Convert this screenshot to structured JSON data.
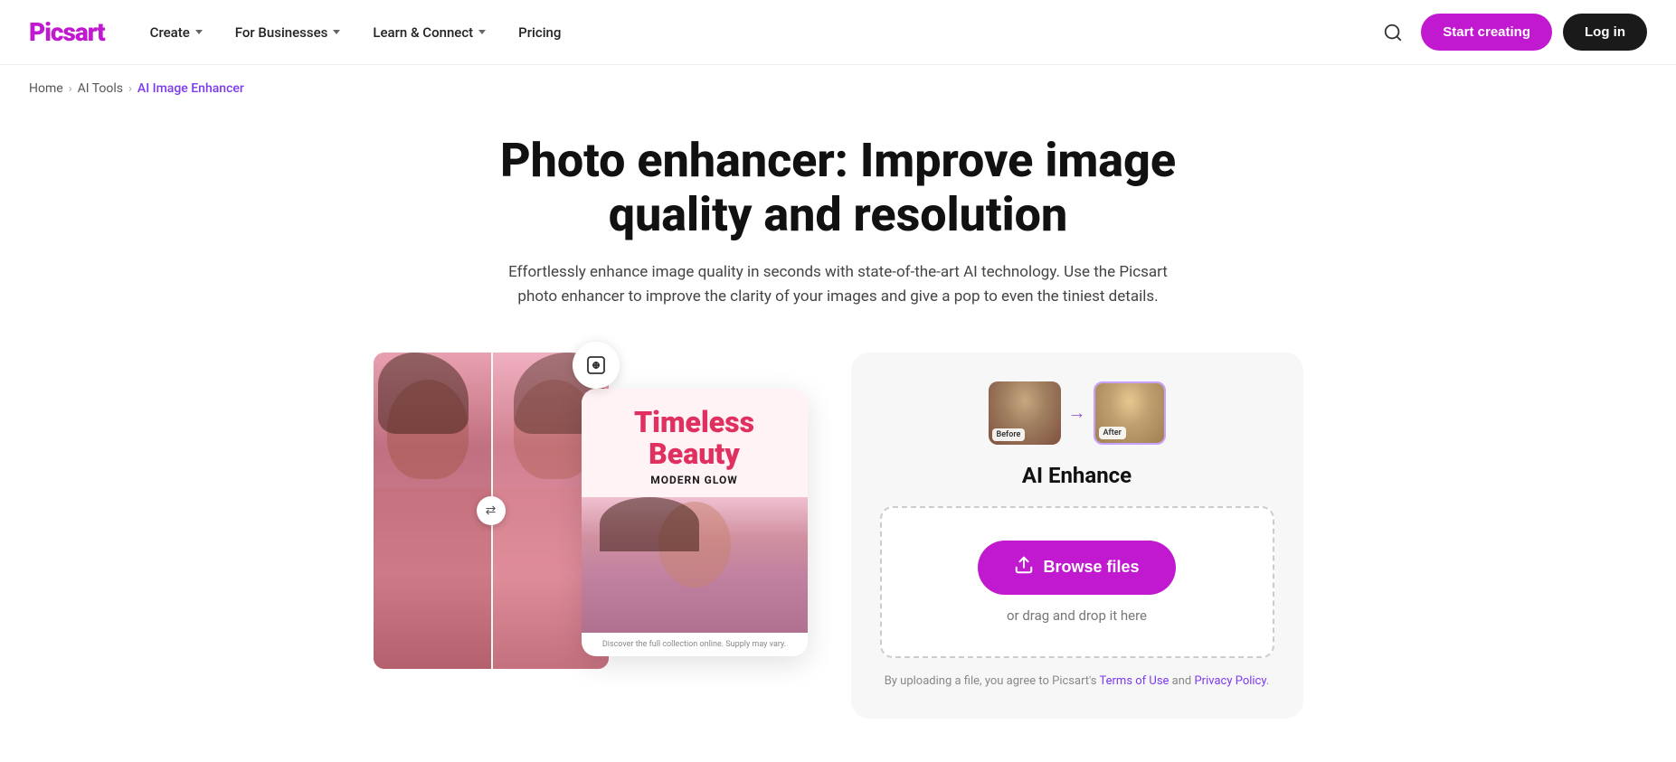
{
  "brand": {
    "logo_text": "Picsart"
  },
  "navbar": {
    "create_label": "Create",
    "for_businesses_label": "For Businesses",
    "learn_connect_label": "Learn & Connect",
    "pricing_label": "Pricing",
    "start_creating_label": "Start creating",
    "login_label": "Log in"
  },
  "breadcrumb": {
    "home": "Home",
    "ai_tools": "AI Tools",
    "current": "AI Image Enhancer"
  },
  "hero": {
    "title": "Photo enhancer: Improve image quality and resolution",
    "subtitle": "Effortlessly enhance image quality in seconds with state-of-the-art AI technology. Use the Picsart photo enhancer to improve the clarity of your images and give a pop to even the tiniest details."
  },
  "demo": {
    "overlay_title_line1": "Timeless",
    "overlay_title_line2": "Beauty",
    "overlay_subtitle": "MODERN GLOW",
    "overlay_footer": "Discover the full collection online. Supply may vary."
  },
  "upload_panel": {
    "before_label": "Before",
    "after_label": "After",
    "title": "AI Enhance",
    "browse_label": "Browse files",
    "drag_text": "or drag and drop it here",
    "tos_text_before": "By uploading a file, you agree to Picsart's ",
    "tos_link1": "Terms of Use",
    "tos_text_middle": " and ",
    "tos_link2": "Privacy Policy",
    "tos_text_after": "."
  },
  "colors": {
    "brand_purple": "#c019d0",
    "link_purple": "#7c3aed"
  }
}
